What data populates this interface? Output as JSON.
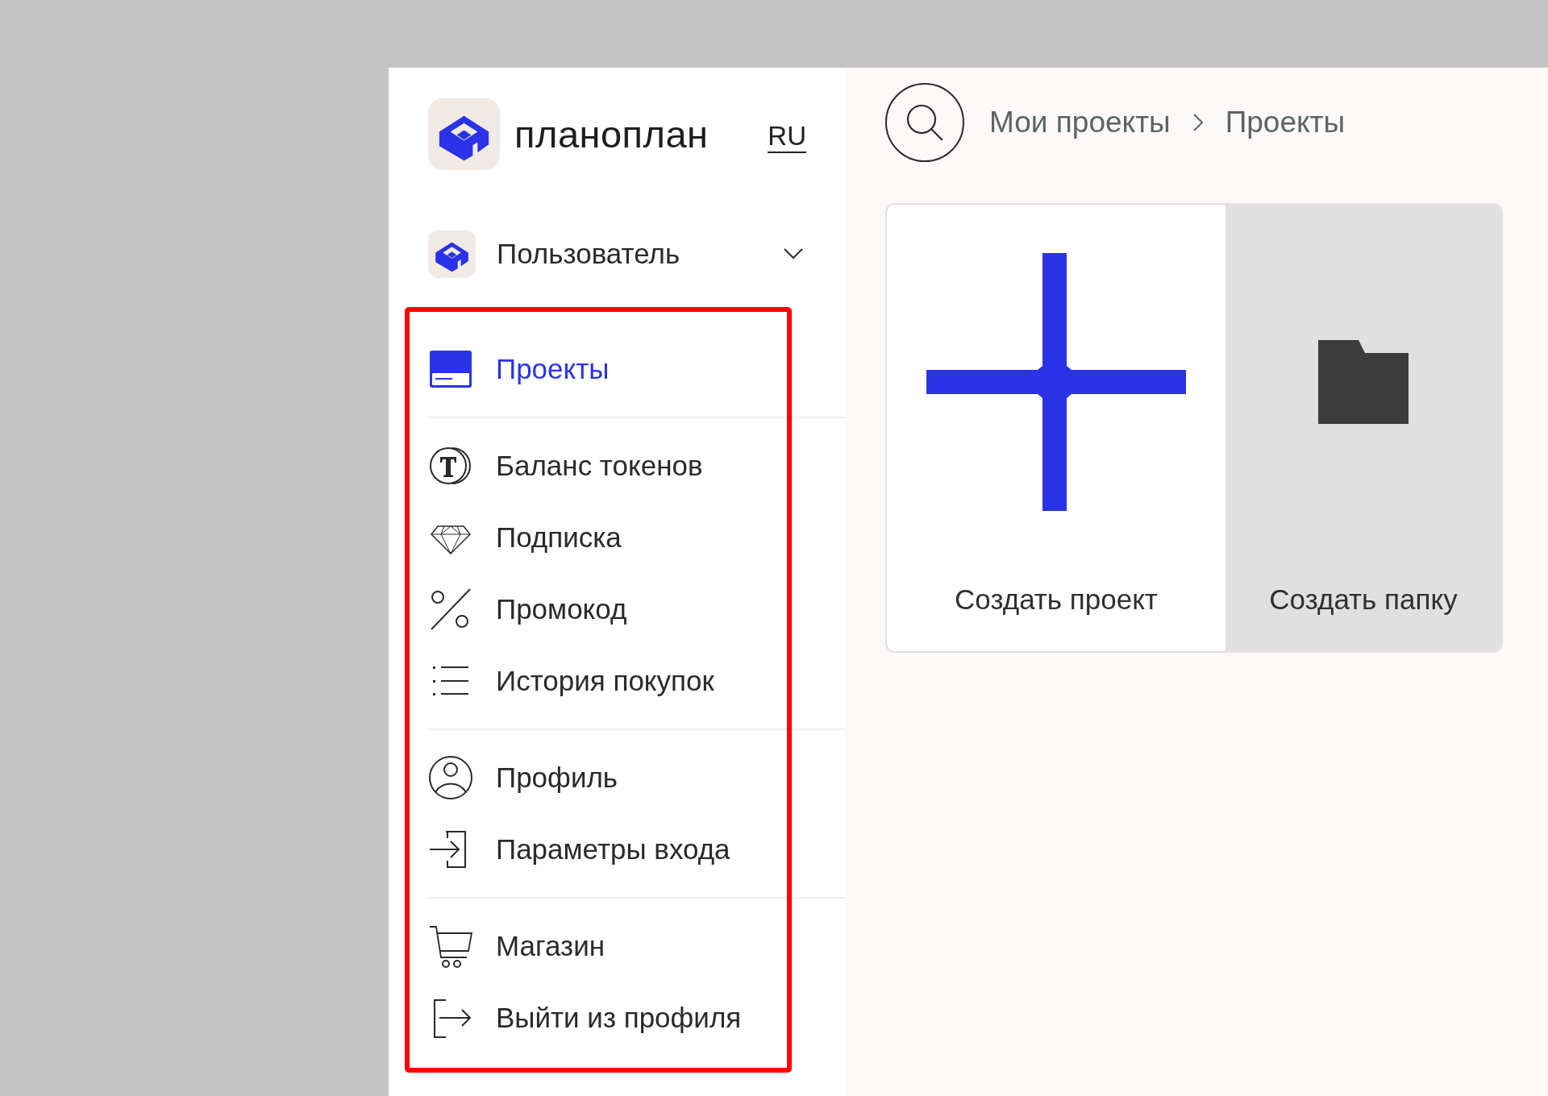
{
  "logo": {
    "name": "планоплан",
    "language": "RU",
    "language_selected": true
  },
  "user": {
    "name": "Пользователь",
    "expanded": false
  },
  "menu_groups": [
    [
      {
        "label": "Проекты",
        "kind": "projects",
        "selected": true
      }
    ],
    [
      {
        "label": "Баланс токенов",
        "kind": "tokens",
        "selected": false
      },
      {
        "label": "Подписка",
        "kind": "subscription",
        "selected": false
      },
      {
        "label": "Промокод",
        "kind": "promo",
        "selected": false
      },
      {
        "label": "История покупок",
        "kind": "history",
        "selected": false
      }
    ],
    [
      {
        "label": "Профиль",
        "kind": "profile",
        "selected": false
      },
      {
        "label": "Параметры входа",
        "kind": "login",
        "selected": false
      }
    ],
    [
      {
        "label": "Магазин",
        "kind": "shop",
        "selected": false
      },
      {
        "label": "Выйти из профиля",
        "kind": "logout",
        "selected": false
      }
    ]
  ],
  "breadcrumb": [
    "Мои проекты",
    "Проекты"
  ],
  "cards": [
    {
      "label": "Создать проект",
      "kind": "new-project"
    },
    {
      "label": "Создать папку",
      "kind": "new-folder"
    }
  ]
}
